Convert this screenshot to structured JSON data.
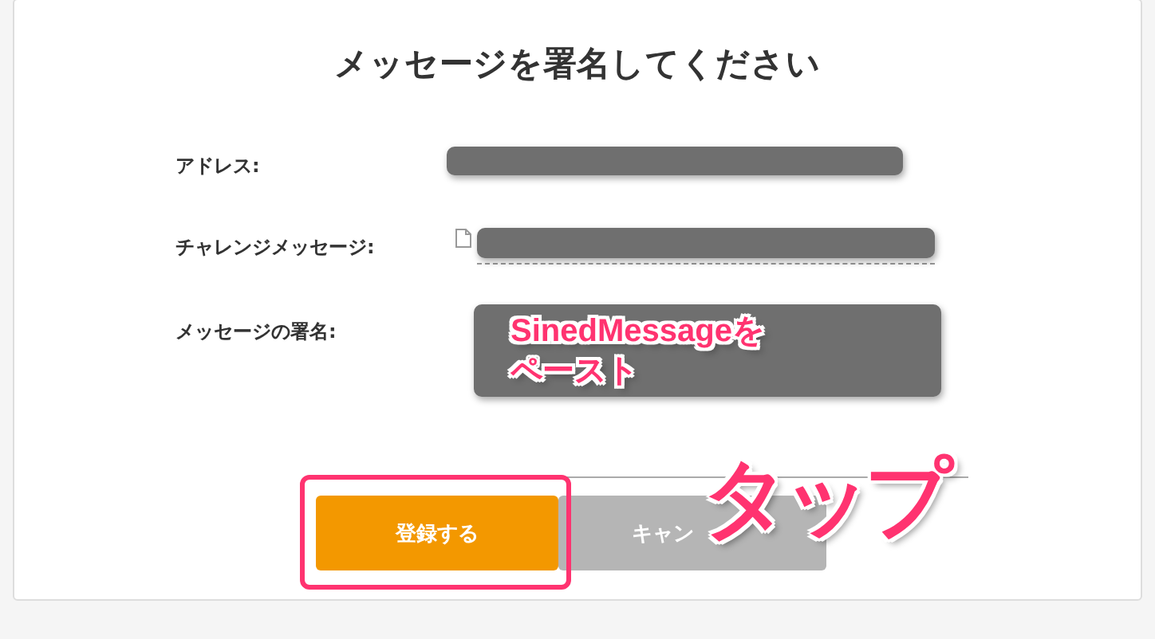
{
  "dialog": {
    "title": "メッセージを署名してください",
    "fields": [
      {
        "label": "アドレス:",
        "kind": "line"
      },
      {
        "label": "チャレンジメッセージ:",
        "kind": "copy"
      },
      {
        "label": "メッセージの署名:",
        "kind": "area"
      }
    ],
    "buttons": [
      {
        "label": "登録する",
        "kind": "primary"
      },
      {
        "label": "キャン",
        "kind": "secondary"
      }
    ]
  },
  "annotations": {
    "paste_note": [
      "SinedMessageを",
      "ペースト"
    ],
    "tap_note": "タップ"
  }
}
